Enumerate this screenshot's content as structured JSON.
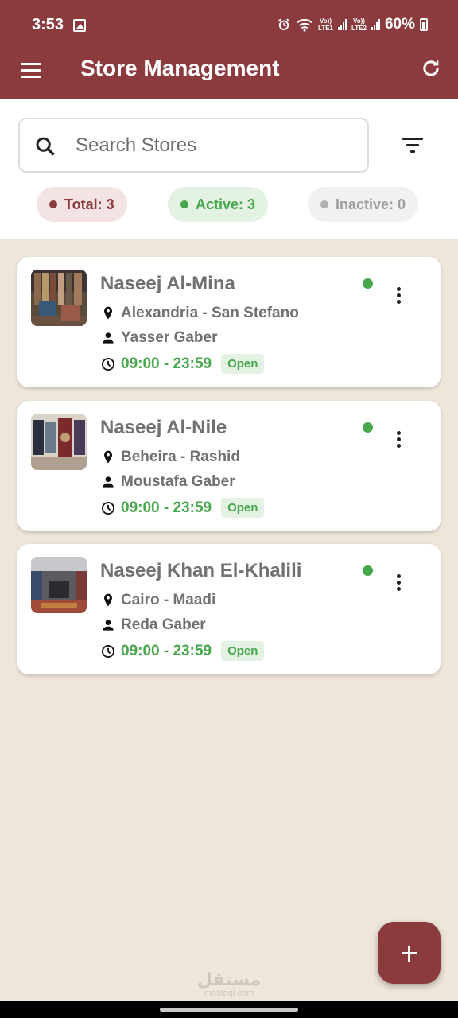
{
  "status_bar": {
    "time": "3:53",
    "network_1_top": "Vo))",
    "network_1_bottom": "LTE1",
    "network_2_top": "Vo))",
    "network_2_bottom": "LTE2",
    "battery": "60%",
    "icons": [
      "gallery-icon",
      "alarm-icon",
      "wifi-icon",
      "signal-icon",
      "battery-icon"
    ]
  },
  "app_bar": {
    "title": "Store Management",
    "background": "#8b3a3e"
  },
  "search": {
    "placeholder": "Search Stores",
    "value": ""
  },
  "summary": {
    "total": "Total: 3",
    "active": "Active: 3",
    "inactive": "Inactive: 0"
  },
  "stores": [
    {
      "name": "Naseej Al-Mina",
      "location": "Alexandria - San Stefano",
      "owner": "Yasser Gaber",
      "hours": "09:00 - 23:59",
      "status": "Open",
      "active": true
    },
    {
      "name": "Naseej Al-Nile",
      "location": "Beheira - Rashid",
      "owner": "Moustafa Gaber",
      "hours": "09:00 - 23:59",
      "status": "Open",
      "active": true
    },
    {
      "name": "Naseej Khan El-Khalili",
      "location": "Cairo - Maadi",
      "owner": "Reda Gaber",
      "hours": "09:00 - 23:59",
      "status": "Open",
      "active": true
    }
  ],
  "watermark": {
    "main": "مستقل",
    "sub": "mostaql.com"
  },
  "colors": {
    "primary": "#8b3a3e",
    "active_green": "#47a74b",
    "inactive_gray": "#9e9e9e",
    "page_background": "#efe6da"
  }
}
